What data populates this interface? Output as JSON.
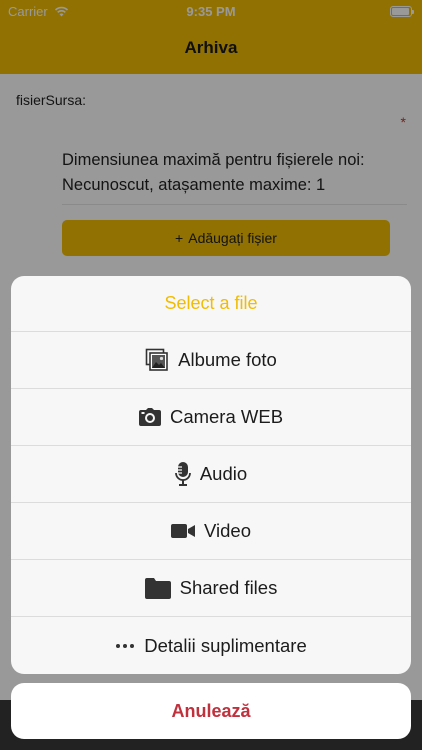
{
  "statusbar": {
    "carrier": "Carrier",
    "time": "9:35 PM"
  },
  "navbar": {
    "title": "Arhiva"
  },
  "form": {
    "field_label": "fisierSursa:",
    "required_mark": "*",
    "info_text": "Dimensiunea maximă pentru fișierele noi: Necunoscut, atașamente maxime: 1",
    "add_button_icon": "+",
    "add_button_label": "Adăugați fișier"
  },
  "sheet": {
    "title": "Select a file",
    "items": [
      {
        "label": "Albume foto",
        "icon": "photo-album-icon"
      },
      {
        "label": "Camera WEB",
        "icon": "camera-icon"
      },
      {
        "label": "Audio",
        "icon": "microphone-icon"
      },
      {
        "label": "Video",
        "icon": "video-camera-icon"
      },
      {
        "label": "Shared files",
        "icon": "folder-icon"
      },
      {
        "label": "Detalii suplimentare",
        "icon": "more-icon"
      }
    ],
    "cancel_label": "Anulează"
  },
  "colors": {
    "accent": "#f0bc04",
    "destructive": "#c1303d"
  }
}
